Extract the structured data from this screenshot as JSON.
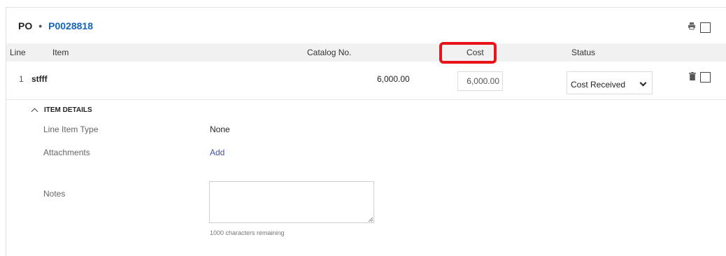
{
  "po": {
    "label": "PO",
    "separator": "•",
    "number": "P0028818"
  },
  "columns": {
    "line": "Line",
    "item": "Item",
    "catalog": "Catalog No.",
    "cost": "Cost",
    "status": "Status"
  },
  "line_items": [
    {
      "line": "1",
      "item": "stfff",
      "amount": "6,000.00",
      "cost_value": "6,000.00",
      "status": "Cost Received"
    }
  ],
  "item_details": {
    "toggle_label": "ITEM DETAILS",
    "line_item_type_label": "Line Item Type",
    "line_item_type_value": "None",
    "attachments_label": "Attachments",
    "attachments_action": "Add",
    "notes_label": "Notes",
    "notes_value": "",
    "chars_remaining": "1000 characters remaining"
  },
  "colors": {
    "accent": "#1565c0",
    "highlight": "#e8141b",
    "link": "#3f51b5"
  },
  "icons": {
    "print": "printer-icon",
    "delete": "trash-icon",
    "collapse": "chevron-up-icon",
    "dropdown": "chevron-down-icon"
  }
}
